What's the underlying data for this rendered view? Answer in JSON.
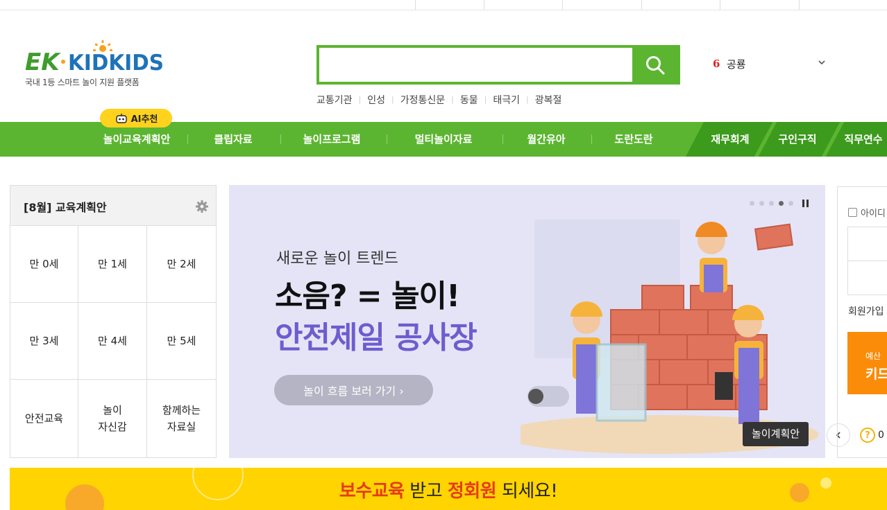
{
  "logo": {
    "brand": "EK·KIDKIDS",
    "tagline": "국내 1등 스마트 놀이 지원 플랫폼",
    "icon": "sun-logo-icon"
  },
  "search": {
    "value": "",
    "placeholder": "",
    "button_icon": "search-icon"
  },
  "keywords": [
    "교통기관",
    "인성",
    "가정통신문",
    "동물",
    "태극기",
    "광복절"
  ],
  "ranking": {
    "number": "6",
    "term": "공룡"
  },
  "gnb": {
    "ai_badge": "AI추천",
    "items": [
      "놀이교육계획안",
      "클립자료",
      "놀이프로그램",
      "멀티놀이자료",
      "월간유아",
      "도란도란"
    ],
    "extra_items": [
      "재무회계",
      "구인구직",
      "직무연수"
    ]
  },
  "plan": {
    "title": "[8월] 교육계획안",
    "cells": [
      "만 0세",
      "만 1세",
      "만 2세",
      "만 3세",
      "만 4세",
      "만 5세",
      "안전교육",
      "놀이\n자신감",
      "함께하는\n자료실"
    ]
  },
  "banner": {
    "subtitle": "새로운 놀이 트렌드",
    "headline": "소음? = 놀이!",
    "headline2": "안전제일 공사장",
    "cta": "놀이 흐름 보러 가기  ›",
    "tag": "놀이계획안",
    "slide_count": 5,
    "active_slide": 4
  },
  "login": {
    "save_id": "아이디",
    "join": "회원가입",
    "ad_line1": "예산",
    "ad_line2": "키드",
    "help": "0"
  },
  "promo": {
    "part1": "보수교육",
    "part2": " 받고 ",
    "part3": "정회원",
    "part4": " 되세요!"
  },
  "colors": {
    "brand_green": "#5cb531",
    "dark_green": "#3c9a1c",
    "yellow": "#ffd400",
    "orange": "#fb8c0a",
    "purple": "#6e5ccf"
  }
}
